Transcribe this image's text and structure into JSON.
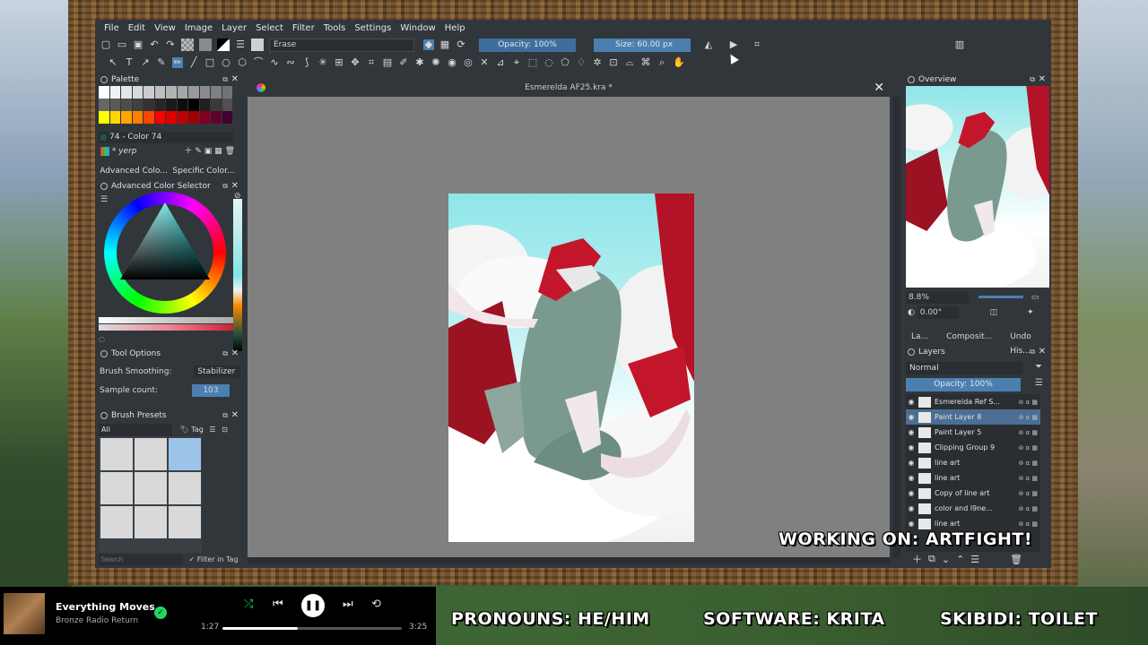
{
  "menu": [
    "File",
    "Edit",
    "View",
    "Image",
    "Layer",
    "Select",
    "Filter",
    "Tools",
    "Settings",
    "Window",
    "Help"
  ],
  "toolbar": {
    "blend_mode": "Erase",
    "opacity_label": "Opacity: 100%",
    "size_label": "Size: 60.00 px"
  },
  "palette": {
    "title": "Palette",
    "current_color": "74 - Color 74",
    "palette_name": "* yerp",
    "advanced_tab": "Advanced Colo...",
    "specific_tab": "Specific Color...",
    "row1": [
      "#ffffff",
      "#f2f2f2",
      "#e6e6e6",
      "#d9d9d9",
      "#cccccc",
      "#bfbfbf",
      "#b3b3b3",
      "#a6a6a6",
      "#999999",
      "#8c8c8c",
      "#808080",
      "#737373"
    ],
    "row2": [
      "#666666",
      "#595959",
      "#4d4d4d",
      "#404040",
      "#333333",
      "#262626",
      "#1a1a1a",
      "#0d0d0d",
      "#000000",
      "#202020",
      "#3a3a3a",
      "#505050"
    ],
    "row3": [
      "#ffff00",
      "#ffd700",
      "#ffa500",
      "#ff7f00",
      "#ff4500",
      "#ff0000",
      "#e00000",
      "#c00000",
      "#a00000",
      "#800020",
      "#600030",
      "#400030"
    ]
  },
  "color_selector": {
    "title": "Advanced Color Selector"
  },
  "tool_options": {
    "title": "Tool Options",
    "smoothing_label": "Brush Smoothing:",
    "smoothing_value": "Stabilizer",
    "sample_label": "Sample count:",
    "sample_value": "103"
  },
  "brush_presets": {
    "title": "Brush Presets",
    "filter": "All",
    "tag": "Tag",
    "search_placeholder": "Search",
    "filter_in_tag": "Filter in Tag"
  },
  "document": {
    "title": "Esmerelda AF25.kra *"
  },
  "overview": {
    "title": "Overview",
    "zoom": "8.8%",
    "rotation": "0.00°"
  },
  "dock_tabs": [
    "La...",
    "Composit...",
    "Undo His..."
  ],
  "layers": {
    "title": "Layers",
    "blend": "Normal",
    "opacity": "Opacity:  100%",
    "items": [
      {
        "name": "Esmerelda Ref S...",
        "active": false
      },
      {
        "name": "Paint Layer 8",
        "active": true
      },
      {
        "name": "Paint Layer 5",
        "active": false
      },
      {
        "name": "Clipping Group 9",
        "active": false
      },
      {
        "name": "line art",
        "active": false
      },
      {
        "name": "line art",
        "active": false
      },
      {
        "name": "Copy of line art",
        "active": false
      },
      {
        "name": "color and l9ne...",
        "active": false
      },
      {
        "name": "line art",
        "active": false
      }
    ]
  },
  "overlay": {
    "working_on": "WORKING ON: ARTFIGHT!",
    "pronouns": "PRONOUNS: HE/HIM",
    "software": "SOFTWARE: KRITA",
    "skibidi": "SKIBIDI: TOILET"
  },
  "player": {
    "track": "Everything Moves",
    "artist": "Bronze Radio Return",
    "elapsed": "1:27",
    "duration": "3:25",
    "progress": 0.42
  }
}
